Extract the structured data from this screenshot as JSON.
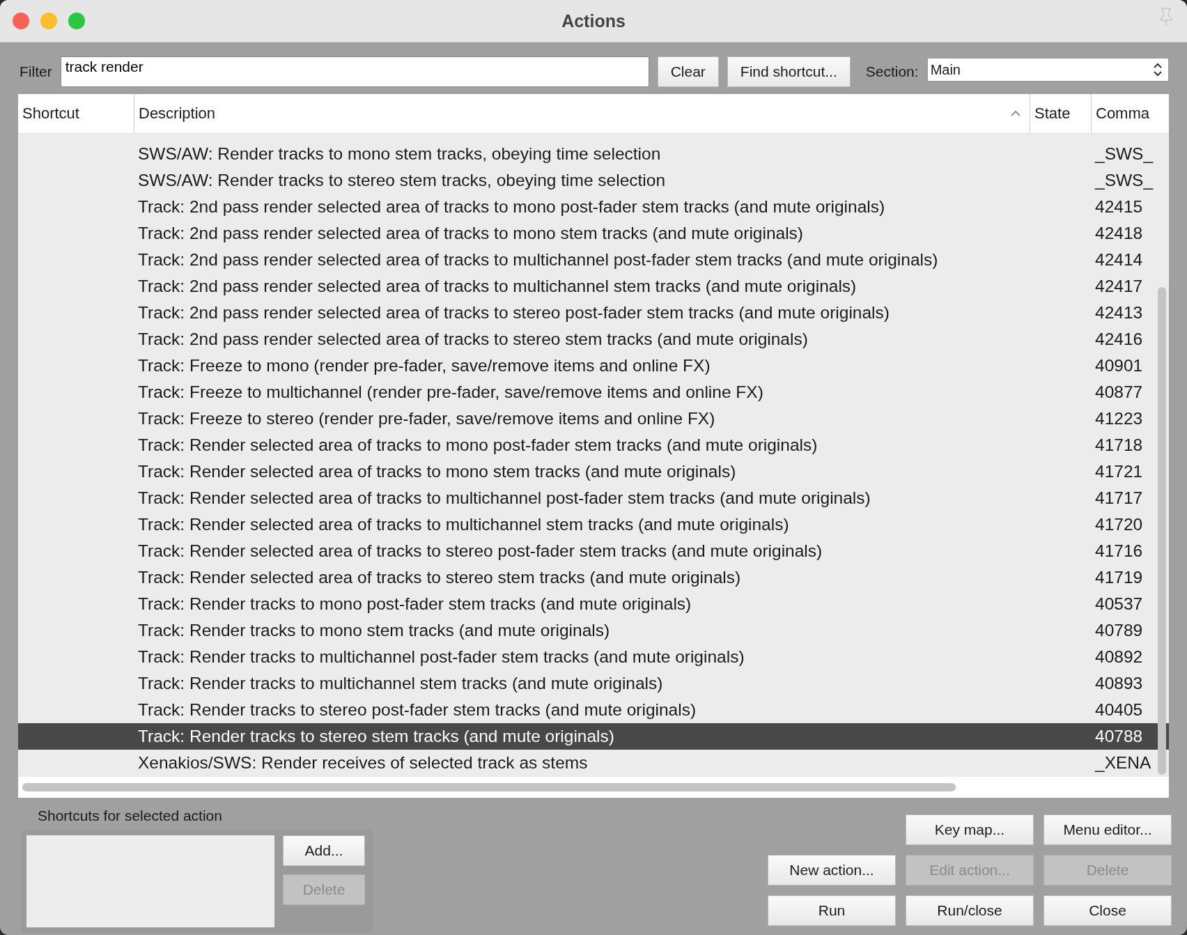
{
  "window": {
    "title": "Actions"
  },
  "filter": {
    "label": "Filter",
    "value": "track render"
  },
  "top_buttons": [
    {
      "label": "Clear"
    },
    {
      "label": "Find shortcut..."
    }
  ],
  "section": {
    "label": "Section:",
    "value": "Main"
  },
  "table": {
    "columns": [
      {
        "label": "Shortcut",
        "sorted": false
      },
      {
        "label": "Description",
        "sorted": true
      },
      {
        "label": "State",
        "sorted": false
      },
      {
        "label": "Comma",
        "sorted": false
      }
    ],
    "rows": [
      {
        "description": "SWS/AW: Render tracks to mono stem tracks, obeying time selection",
        "command": "_SWS_",
        "selected": false
      },
      {
        "description": "SWS/AW: Render tracks to stereo stem tracks, obeying time selection",
        "command": "_SWS_",
        "selected": false
      },
      {
        "description": "Track: 2nd pass render selected area of tracks to mono post-fader stem tracks (and mute originals)",
        "command": "42415",
        "selected": false
      },
      {
        "description": "Track: 2nd pass render selected area of tracks to mono stem tracks (and mute originals)",
        "command": "42418",
        "selected": false
      },
      {
        "description": "Track: 2nd pass render selected area of tracks to multichannel post-fader stem tracks (and mute originals)",
        "command": "42414",
        "selected": false
      },
      {
        "description": "Track: 2nd pass render selected area of tracks to multichannel stem tracks (and mute originals)",
        "command": "42417",
        "selected": false
      },
      {
        "description": "Track: 2nd pass render selected area of tracks to stereo post-fader stem tracks (and mute originals)",
        "command": "42413",
        "selected": false
      },
      {
        "description": "Track: 2nd pass render selected area of tracks to stereo stem tracks (and mute originals)",
        "command": "42416",
        "selected": false
      },
      {
        "description": "Track: Freeze to mono (render pre-fader, save/remove items and online FX)",
        "command": "40901",
        "selected": false
      },
      {
        "description": "Track: Freeze to multichannel (render pre-fader, save/remove items and online FX)",
        "command": "40877",
        "selected": false
      },
      {
        "description": "Track: Freeze to stereo (render pre-fader, save/remove items and online FX)",
        "command": "41223",
        "selected": false
      },
      {
        "description": "Track: Render selected area of tracks to mono post-fader stem tracks (and mute originals)",
        "command": "41718",
        "selected": false
      },
      {
        "description": "Track: Render selected area of tracks to mono stem tracks (and mute originals)",
        "command": "41721",
        "selected": false
      },
      {
        "description": "Track: Render selected area of tracks to multichannel post-fader stem tracks (and mute originals)",
        "command": "41717",
        "selected": false
      },
      {
        "description": "Track: Render selected area of tracks to multichannel stem tracks (and mute originals)",
        "command": "41720",
        "selected": false
      },
      {
        "description": "Track: Render selected area of tracks to stereo post-fader stem tracks (and mute originals)",
        "command": "41716",
        "selected": false
      },
      {
        "description": "Track: Render selected area of tracks to stereo stem tracks (and mute originals)",
        "command": "41719",
        "selected": false
      },
      {
        "description": "Track: Render tracks to mono post-fader stem tracks (and mute originals)",
        "command": "40537",
        "selected": false
      },
      {
        "description": "Track: Render tracks to mono stem tracks (and mute originals)",
        "command": "40789",
        "selected": false
      },
      {
        "description": "Track: Render tracks to multichannel post-fader stem tracks (and mute originals)",
        "command": "40892",
        "selected": false
      },
      {
        "description": "Track: Render tracks to multichannel stem tracks (and mute originals)",
        "command": "40893",
        "selected": false
      },
      {
        "description": "Track: Render tracks to stereo post-fader stem tracks (and mute originals)",
        "command": "40405",
        "selected": false
      },
      {
        "description": "Track: Render tracks to stereo stem tracks (and mute originals)",
        "command": "40788",
        "selected": true
      },
      {
        "description": "Xenakios/SWS: Render receives of selected track as stems",
        "command": "_XENA",
        "selected": false
      }
    ]
  },
  "shortcuts_panel": {
    "label": "Shortcuts for selected action",
    "buttons": [
      {
        "label": "Add...",
        "disabled": false
      },
      {
        "label": "Delete",
        "disabled": true
      }
    ]
  },
  "action_buttons": [
    {
      "label": "Key map...",
      "disabled": false
    },
    {
      "label": "Menu editor...",
      "disabled": false
    },
    {
      "label": "New action...",
      "disabled": false
    },
    {
      "label": "Edit action...",
      "disabled": true
    },
    {
      "label": "Delete",
      "disabled": true
    },
    {
      "label": "Run",
      "disabled": false
    },
    {
      "label": "Run/close",
      "disabled": false
    },
    {
      "label": "Close",
      "disabled": false
    }
  ]
}
